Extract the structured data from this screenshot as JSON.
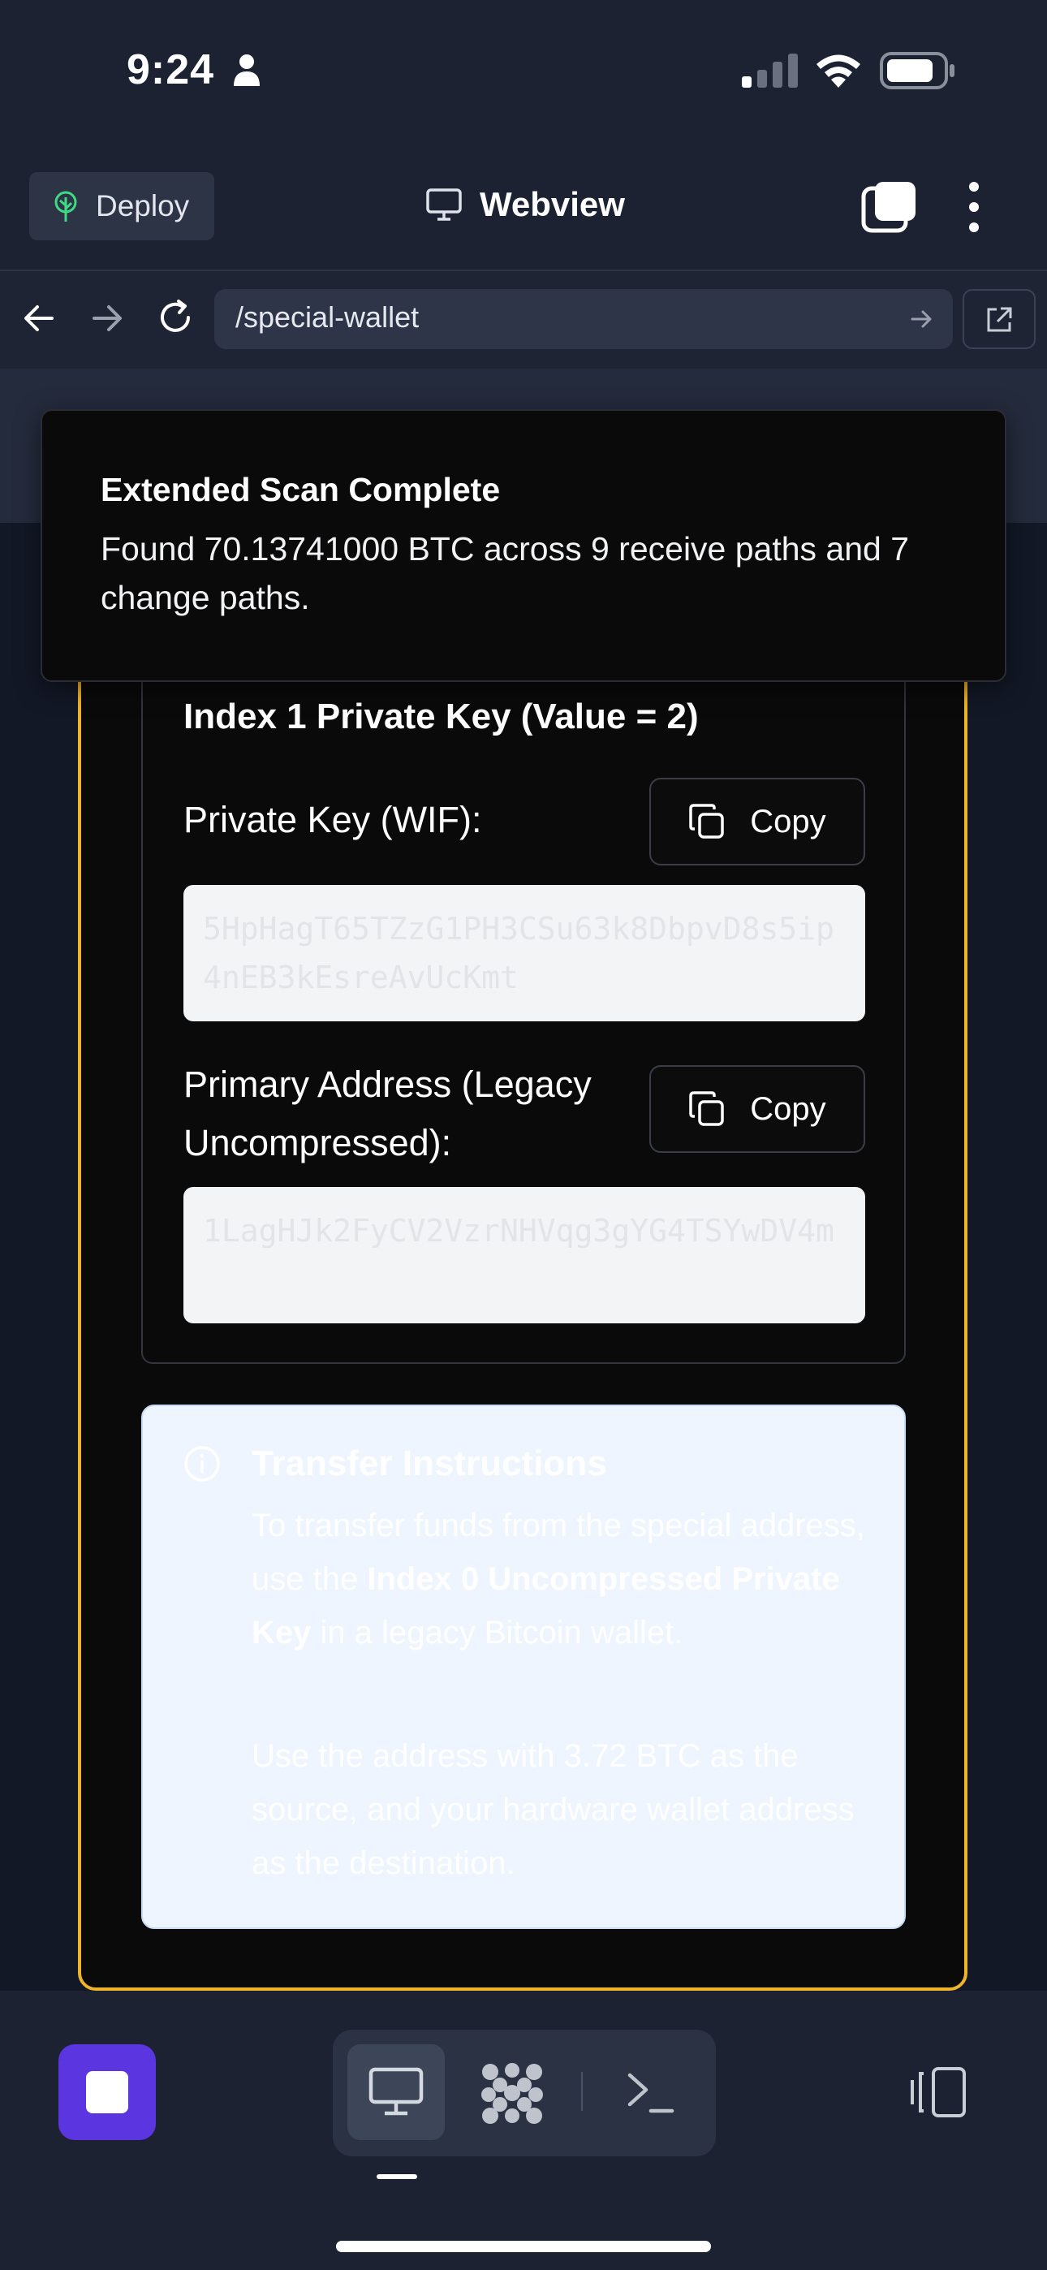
{
  "status_bar": {
    "time": "9:24"
  },
  "header": {
    "deploy_label": "Deploy",
    "title": "Webview"
  },
  "url_bar": {
    "url": "/special-wallet"
  },
  "toast": {
    "title": "Extended Scan Complete",
    "message": "Found 70.13741000 BTC across 9 receive paths and 7 change paths."
  },
  "key_panel": {
    "heading": "Index 1 Private Key (Value = 2)",
    "wif_label": "Private Key (WIF):",
    "wif_value": "5HpHagT65TZzG1PH3CSu63k8DbpvD8s5ip4nEB3kEsreAvUcKmt",
    "address_label": "Primary Address (Legacy Uncompressed):",
    "address_value": "1LagHJk2FyCV2VzrNHVqg3gYG4TSYwDV4m",
    "copy_label": "Copy"
  },
  "transfer": {
    "title": "Transfer Instructions",
    "p1_before": "To transfer funds from the special address, use the ",
    "p1_bold": "Index 0 Uncompressed Private Key",
    "p1_after": " in a legacy Bitcoin wallet.",
    "p2": "Use the address with 3.72 BTC as the source, and your hardware wallet address as the destination."
  },
  "colors": {
    "accent_border": "#f0b429",
    "stop_button": "#5b35e0",
    "deploy_icon": "#3ddc84"
  },
  "icons": [
    "person-icon",
    "cellular-icon",
    "wifi-icon",
    "battery-icon",
    "tree-icon",
    "monitor-icon",
    "tabs-icon",
    "more-icon",
    "back-arrow-icon",
    "forward-arrow-icon",
    "reload-icon",
    "go-arrow-icon",
    "external-link-icon",
    "copy-icon",
    "info-icon",
    "stop-icon",
    "grid-icon",
    "terminal-icon",
    "device-rotate-icon"
  ]
}
